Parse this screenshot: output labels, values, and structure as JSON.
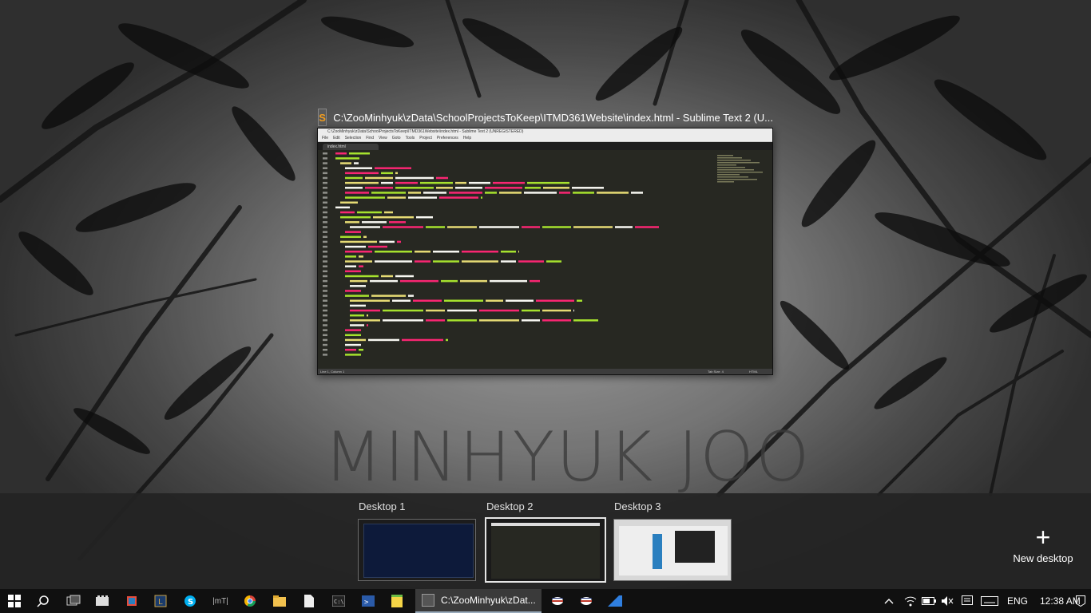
{
  "window": {
    "title": "C:\\ZooMinhyuk\\zData\\SchoolProjectsToKeep\\ITMD361Website\\index.html - Sublime Text 2 (U...",
    "app_icon": "S",
    "inner_title": "C:\\ZooMinhyuk\\zData\\SchoolProjectsToKeep\\ITMD361Website\\index.html - Sublime Text 2 (UNREGISTERED)",
    "menu": [
      "File",
      "Edit",
      "Selection",
      "Find",
      "View",
      "Goto",
      "Tools",
      "Project",
      "Preferences",
      "Help"
    ],
    "tab": "index.html",
    "status_left": "Line 1, Column 1",
    "status_mid": "Tab Size: 4",
    "status_right": "HTML"
  },
  "wallpaper_text": "MINHYUK JOO",
  "desktops": [
    {
      "label": "Desktop 1"
    },
    {
      "label": "Desktop 2"
    },
    {
      "label": "Desktop 3"
    }
  ],
  "new_desktop_label": "New desktop",
  "taskbar": {
    "app_label": "C:\\ZooMinhyuk\\zDat...",
    "language": "ENG",
    "time": "12:38 AM"
  },
  "colors": {
    "accent": "#f29d1f",
    "tag": "#f92672",
    "attr": "#a6e22e",
    "string": "#e6db74",
    "text": "#f8f8f2"
  }
}
